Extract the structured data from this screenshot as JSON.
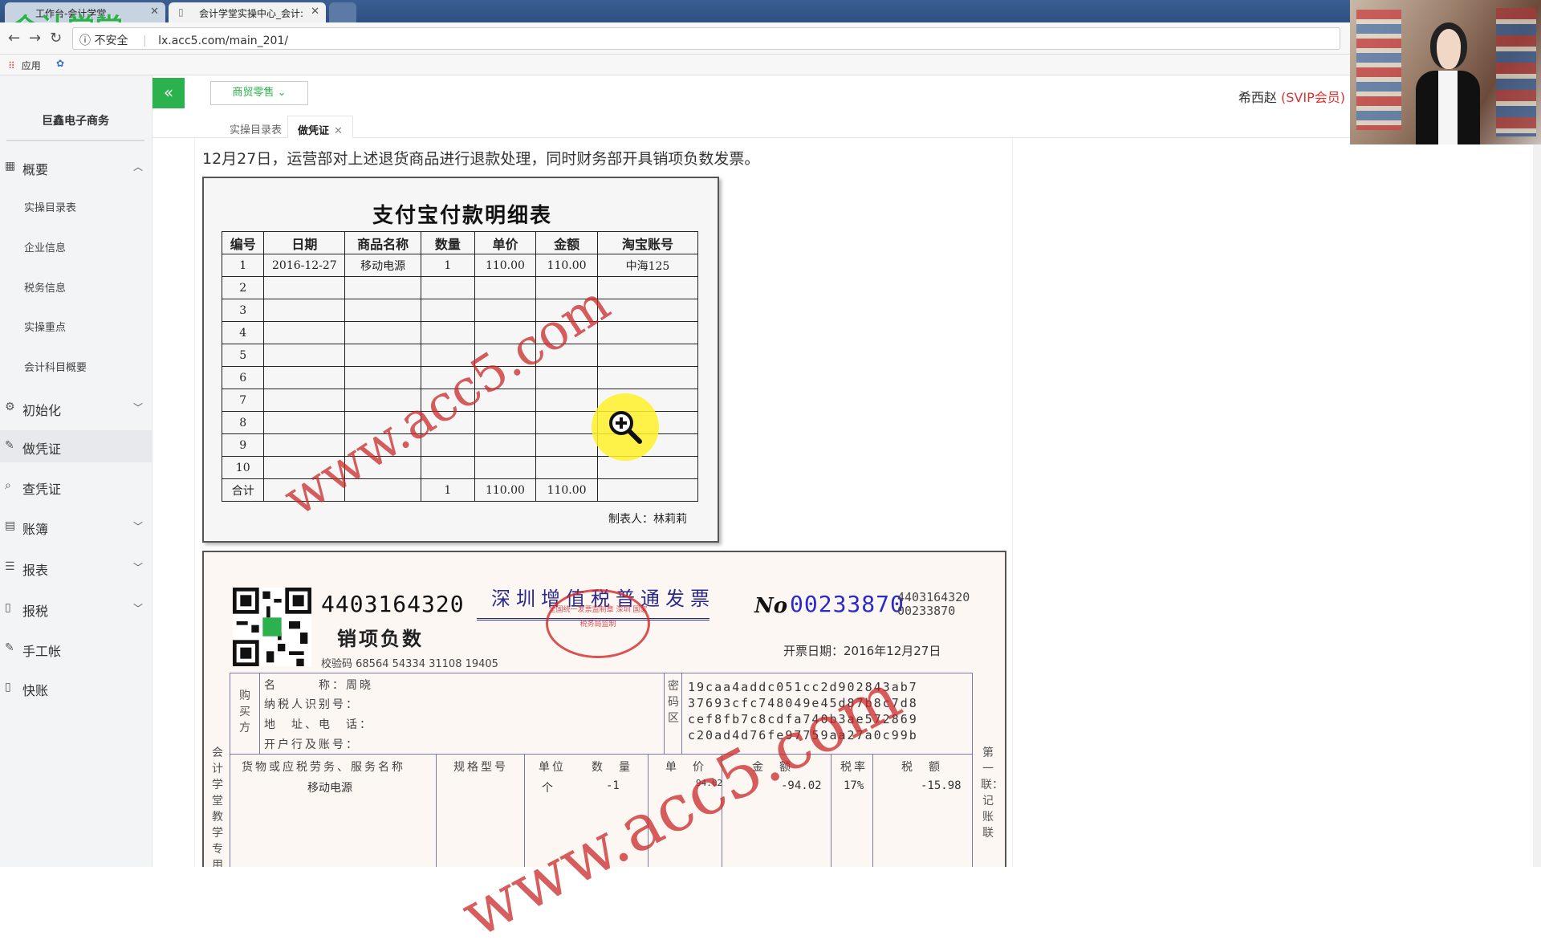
{
  "browser": {
    "tabs": [
      {
        "label": "工作台-会计学堂"
      },
      {
        "label": "会计学堂实操中心_会计:"
      }
    ],
    "logo_text": "会计学堂",
    "insecure_label": "不安全",
    "url": "lx.acc5.com/main_201/",
    "bookmark_apps": "应用"
  },
  "sidebar": {
    "company": "巨鑫电子商务",
    "items": [
      {
        "label": "概要"
      },
      {
        "label": "初始化"
      },
      {
        "label": "做凭证"
      },
      {
        "label": "查凭证"
      },
      {
        "label": "账簿"
      },
      {
        "label": "报表"
      },
      {
        "label": "报税"
      },
      {
        "label": "手工帐"
      },
      {
        "label": "快账"
      }
    ],
    "sub_items": [
      {
        "label": "实操目录表"
      },
      {
        "label": "企业信息"
      },
      {
        "label": "税务信息"
      },
      {
        "label": "实操重点"
      },
      {
        "label": "会计科目概要"
      }
    ]
  },
  "topbar": {
    "collapse_icon": "«",
    "industry_select": "商贸零售",
    "user_name": "希西赵",
    "user_level": "(SVIP会员)"
  },
  "content_tabs": [
    {
      "label": "实操目录表"
    },
    {
      "label": "做凭证"
    }
  ],
  "instruction": "12月27日，运营部对上述退货商品进行退款处理，同时财务部开具销项负数发票。",
  "alipay": {
    "title": "支付宝付款明细表",
    "headers": [
      "编号",
      "日期",
      "商品名称",
      "数量",
      "单价",
      "金额",
      "淘宝账号"
    ],
    "rows": [
      [
        "1",
        "2016-12-27",
        "移动电源",
        "1",
        "110.00",
        "110.00",
        "中海125"
      ],
      [
        "2",
        "",
        "",
        "",
        "",
        "",
        ""
      ],
      [
        "3",
        "",
        "",
        "",
        "",
        "",
        ""
      ],
      [
        "4",
        "",
        "",
        "",
        "",
        "",
        ""
      ],
      [
        "5",
        "",
        "",
        "",
        "",
        "",
        ""
      ],
      [
        "6",
        "",
        "",
        "",
        "",
        "",
        ""
      ],
      [
        "7",
        "",
        "",
        "",
        "",
        "",
        ""
      ],
      [
        "8",
        "",
        "",
        "",
        "",
        "",
        ""
      ],
      [
        "9",
        "",
        "",
        "",
        "",
        "",
        ""
      ],
      [
        "10",
        "",
        "",
        "",
        "",
        "",
        ""
      ]
    ],
    "total": [
      "合计",
      "",
      "",
      "1",
      "110.00",
      "110.00",
      ""
    ],
    "maker": "制表人：林莉莉",
    "watermark": "www.acc5.com"
  },
  "invoice": {
    "code_big": "4403164320",
    "negative_label": "销项负数",
    "check_code": "校验码 68564 54334 31108 19405",
    "title": "深圳增值税普通发票",
    "seal_text": "全国统一发票监制章 深圳 国家税务局监制",
    "no_label": "No",
    "number": "00233870",
    "code_small_1": "4403164320",
    "code_small_2": "00233870",
    "date": "开票日期：2016年12月27日",
    "buyer_side": "购买方",
    "buyer_name_label": "名　　　称：",
    "buyer_name": "周晓",
    "buyer_taxid_label": "纳税人识别号：",
    "buyer_addr_label": "地　址、电　话：",
    "buyer_bank_label": "开户行及账号：",
    "cipher_side": "密码区",
    "cipher": [
      "19caa4addc051cc2d902843ab7",
      "37693cfc748049e45d87b8c7d8",
      "cef8fb7c8cdfa740b3ae572869",
      "c20ad4d76fe97759aa27a0c99b"
    ],
    "left_vertical": "会计学堂教学专用",
    "right_vertical": "第一联：记账联",
    "goods_headers": [
      "货物或应税劳务、服务名称",
      "规格型号",
      "单位",
      "数　量",
      "单　价",
      "金　额",
      "税率",
      "税　额"
    ],
    "goods_row": [
      "移动电源",
      "",
      "个",
      "-1",
      "94.02",
      "-94.02",
      "17%",
      "-15.98"
    ]
  }
}
